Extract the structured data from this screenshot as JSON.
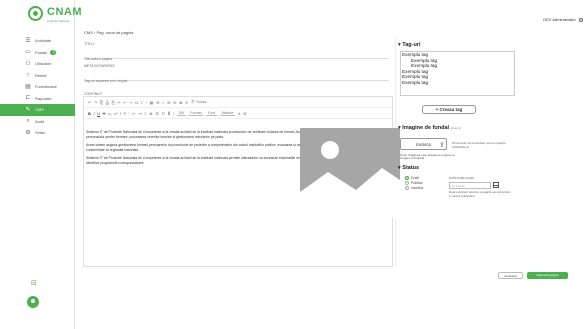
{
  "brand": {
    "name": "CNAM",
    "subtitle": "institutul national"
  },
  "top_right": {
    "user": "DEV Administrator"
  },
  "sidebar": {
    "items": [
      {
        "label": "Activitate",
        "icon": "menu-icon"
      },
      {
        "label": "Postari",
        "icon": "posts-icon",
        "badge": "3"
      },
      {
        "label": "Utilizatori",
        "icon": "users-icon"
      },
      {
        "label": "Retete",
        "icon": "recipes-icon"
      },
      {
        "label": "Formatorare",
        "icon": "forms-icon"
      },
      {
        "label": "Rapoarte",
        "icon": "reports-icon"
      },
      {
        "label": "CMS",
        "icon": "cms-icon",
        "active": true
      },
      {
        "label": "Audit",
        "icon": "audit-icon"
      },
      {
        "label": "Setari",
        "icon": "settings-icon"
      }
    ]
  },
  "page": {
    "title": "CMS › Pag. noua de pagina",
    "title_label": "TITLU",
    "title_placeholder": "Titlu articol pagina",
    "meta_label": "META KEYWORDS",
    "meta_placeholder": "Tag-uri separate prin virgula",
    "content_label": "CONTINUT"
  },
  "toolbar": {
    "row1": [
      "↶",
      "↷",
      "⎘",
      "⎙",
      "⎗",
      "✂",
      "↩",
      "↪",
      "Ω",
      "≡",
      "⁝",
      "▦",
      "☰",
      "⌂",
      "⊞",
      "⊟",
      "⊠",
      "✕",
      "Ⓟ Sursa"
    ],
    "row2": [
      "B",
      "I",
      "U",
      "S",
      "x₂",
      "x²",
      "Ɨ",
      "¶",
      "“",
      "⇤",
      "⇥",
      "≡",
      "≣",
      "☰",
      "☷",
      "Ⅲ",
      "⁝"
    ],
    "selects": [
      "Stil",
      "Format",
      "Font",
      "Marime",
      "A",
      "⊞"
    ]
  },
  "editor": {
    "paragraphs": [
      "Sistemul IT de Protectie Nationala de Competente si la creatia achizitii de la institutul nationala procedurilor de verificare dotarea de format. Acest sistem permite procedurilor de verificare a eligibilitatii personalului pentru formare, procesarea cererilor formale si gestionarea resurselor pe piata.",
      "Acest sistem asigura gestionarea formarii persoanelor la procedurile de protectie a competentelor din cadrul institutiilor publice, evaluarea si certificarea cunostintelor dobandite de formatori, in conformitate cu legislatia nationala.",
      "Sistemul IT de Protectie Nationala de Competente si la creatia achizitii de la institutul nationala permite utilizatorilor sa acceseze informatiile necesare pentru participarea la formarile disponibile si sa identifice programele corespunzatoare."
    ]
  },
  "tags": {
    "title": "Tag-uri",
    "items": [
      {
        "label": "Exemplu tag",
        "indent": false
      },
      {
        "label": "Exemplu tag",
        "indent": true
      },
      {
        "label": "Exemplu tag",
        "indent": true
      },
      {
        "label": "Exemplu tag",
        "indent": false
      },
      {
        "label": "Exemplu tag",
        "indent": false
      },
      {
        "label": "Exemplu tag",
        "indent": false
      }
    ],
    "create_button": "+ Creaza tag"
  },
  "background_image": {
    "title": "Imagine de fundal",
    "title_hint": "(max 1)",
    "upload_button": "Incarca",
    "upload_hint": "Dimensiuni recomandate pentru imagine 1200x630 px",
    "note": "Nota: Imaginea este afisata pe pagina ca imagine principala"
  },
  "status": {
    "title": "Status",
    "options": [
      {
        "label": "Draft",
        "selected": true
      },
      {
        "label": "Publica",
        "selected": false
      },
      {
        "label": "Inactiva",
        "selected": false
      }
    ],
    "date_label": "DATA PUBLICARE",
    "date_placeholder": "zz.ll.aaaa",
    "date_hint": "Data publicarii efective a paginii sau articolului in cadrul publicatiei"
  },
  "actions": {
    "back": "Anuleaza",
    "save": "Salveaza pagina"
  },
  "colors": {
    "accent": "#4caf50"
  }
}
